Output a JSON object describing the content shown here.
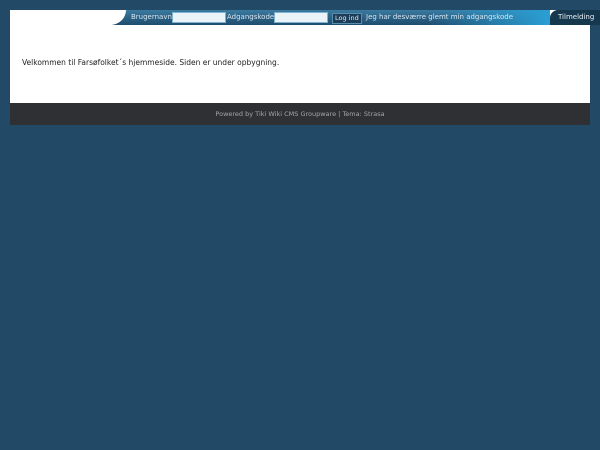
{
  "login": {
    "username_label": "Brugernavn:",
    "username_value": "",
    "password_label": "Adgangskode:",
    "password_value": "",
    "login_button": "Log ind",
    "forgot_link": "Jeg har desværre glemt min adgangskode"
  },
  "register": {
    "label": "Tilmelding"
  },
  "main": {
    "welcome_text": "Velkommen til Farsøfolket´s hjemmeside. Siden er under opbygning."
  },
  "footer": {
    "powered_by": "Powered by",
    "cms_link": "Tiki Wiki CMS Groupware",
    "separator": "|",
    "theme_label": "Tema:",
    "theme_link": "Strasa"
  },
  "colors": {
    "background": "#224a66",
    "footer": "#2f3033",
    "accent": "#2a9fd4"
  }
}
